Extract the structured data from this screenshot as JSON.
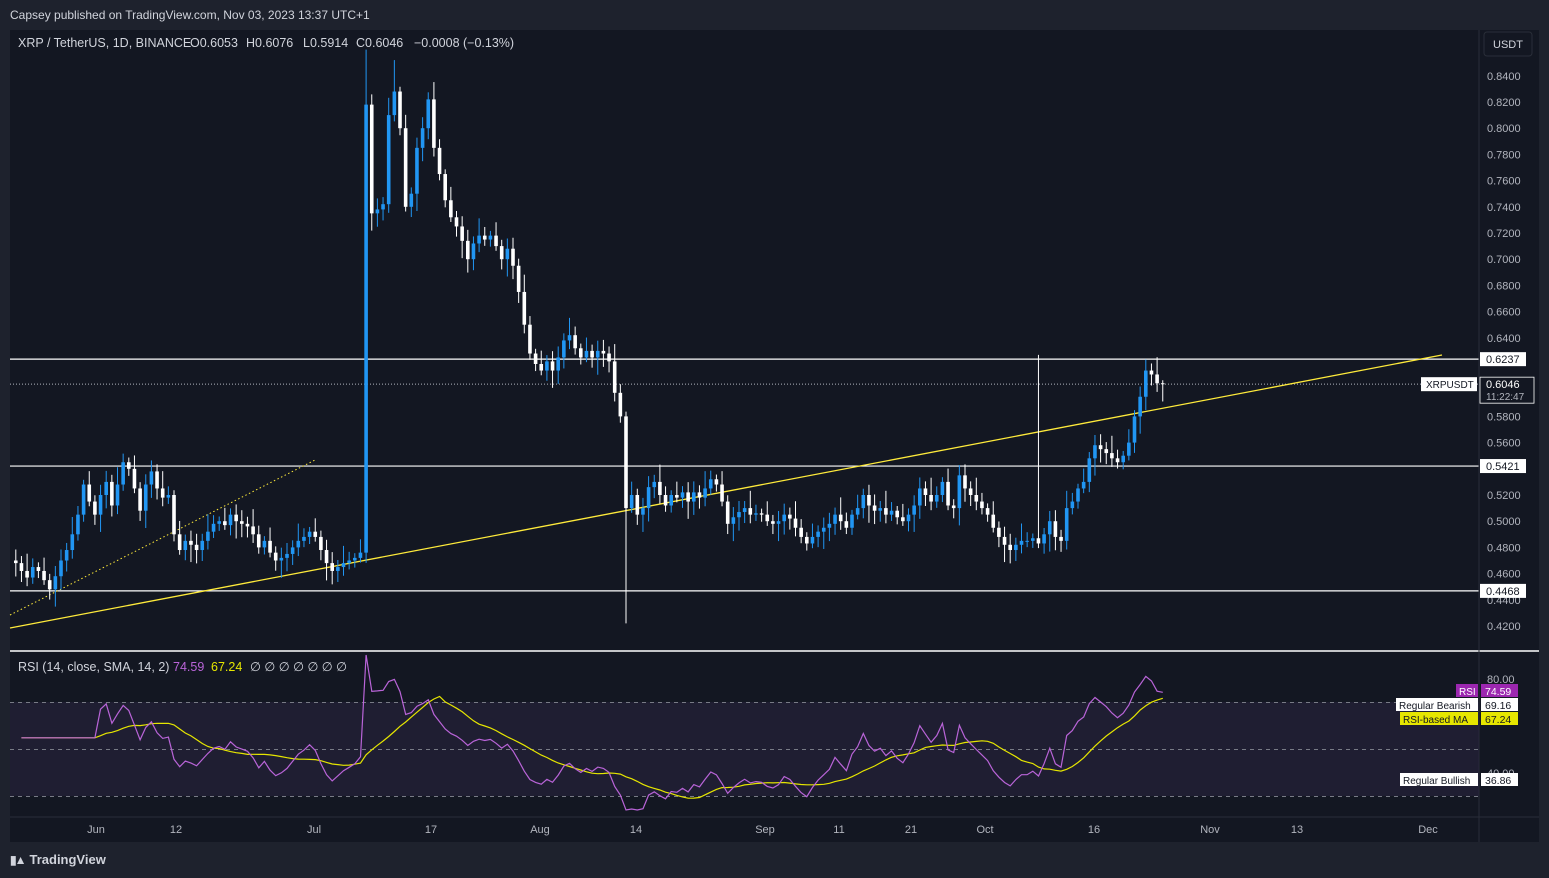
{
  "publisher_line": "Capsey published on TradingView.com, Nov 03, 2023 13:37 UTC+1",
  "header": {
    "symbol": "XRP / TetherUS, 1D, BINANCE",
    "open": "O0.6053",
    "high": "H0.6076",
    "low": "L0.5914",
    "close": "C0.6046",
    "change": "−0.0008 (−0.13%)"
  },
  "currency_button": "USDT",
  "footer_brand": "TradingView",
  "colors": {
    "background": "#131722",
    "up_candle": "#2196f3",
    "down_candle": "#ffffff",
    "trendline": "#ffeb3b",
    "rsi_line": "#b964d8",
    "rsi_ma": "#e6e600",
    "rsi_band": "#2a2540"
  },
  "chart_data": [
    {
      "type": "candlestick",
      "title": "XRP / TetherUS, 1D, BINANCE",
      "ylabel": "USDT",
      "ylim": [
        0.41,
        0.855
      ],
      "y_ticks": [
        "0.8400",
        "0.8200",
        "0.8000",
        "0.7800",
        "0.7600",
        "0.7400",
        "0.7200",
        "0.7000",
        "0.6800",
        "0.6600",
        "0.6400",
        "0.5800",
        "0.5600",
        "0.5200",
        "0.5000",
        "0.4800",
        "0.4600",
        "0.4400",
        "0.4200"
      ],
      "x_ticks": [
        "Jun",
        "12",
        "Jul",
        "17",
        "Aug",
        "14",
        "Sep",
        "11",
        "21",
        "Oct",
        "16",
        "Nov",
        "13",
        "Dec"
      ],
      "candles_close": [
        0.468,
        0.462,
        0.457,
        0.465,
        0.462,
        0.455,
        0.448,
        0.458,
        0.47,
        0.478,
        0.49,
        0.505,
        0.528,
        0.515,
        0.505,
        0.52,
        0.53,
        0.512,
        0.528,
        0.545,
        0.54,
        0.525,
        0.508,
        0.528,
        0.538,
        0.525,
        0.518,
        0.52,
        0.49,
        0.478,
        0.485,
        0.482,
        0.478,
        0.485,
        0.492,
        0.498,
        0.5,
        0.497,
        0.505,
        0.5,
        0.498,
        0.496,
        0.49,
        0.48,
        0.485,
        0.476,
        0.47,
        0.472,
        0.475,
        0.48,
        0.485,
        0.488,
        0.492,
        0.488,
        0.478,
        0.468,
        0.462,
        0.465,
        0.468,
        0.47,
        0.472,
        0.476,
        0.818,
        0.735,
        0.738,
        0.742,
        0.81,
        0.828,
        0.8,
        0.74,
        0.75,
        0.785,
        0.8,
        0.822,
        0.785,
        0.765,
        0.745,
        0.732,
        0.725,
        0.714,
        0.7,
        0.712,
        0.718,
        0.715,
        0.718,
        0.71,
        0.7,
        0.708,
        0.695,
        0.675,
        0.65,
        0.628,
        0.62,
        0.615,
        0.622,
        0.615,
        0.625,
        0.638,
        0.642,
        0.632,
        0.625,
        0.63,
        0.625,
        0.63,
        0.628,
        0.622,
        0.598,
        0.58,
        0.51,
        0.52,
        0.505,
        0.51,
        0.526,
        0.53,
        0.52,
        0.512,
        0.52,
        0.518,
        0.522,
        0.515,
        0.522,
        0.518,
        0.525,
        0.532,
        0.528,
        0.515,
        0.498,
        0.503,
        0.507,
        0.51,
        0.505,
        0.506,
        0.505,
        0.5,
        0.498,
        0.5,
        0.505,
        0.502,
        0.495,
        0.488,
        0.483,
        0.488,
        0.492,
        0.495,
        0.498,
        0.505,
        0.5,
        0.495,
        0.505,
        0.51,
        0.52,
        0.512,
        0.508,
        0.51,
        0.505,
        0.508,
        0.503,
        0.5,
        0.505,
        0.512,
        0.525,
        0.52,
        0.515,
        0.52,
        0.53,
        0.512,
        0.51,
        0.535,
        0.525,
        0.52,
        0.515,
        0.51,
        0.505,
        0.495,
        0.488,
        0.482,
        0.478,
        0.482,
        0.485,
        0.485,
        0.487,
        0.483,
        0.49,
        0.5,
        0.488,
        0.485,
        0.51,
        0.515,
        0.525,
        0.53,
        0.548,
        0.558,
        0.555,
        0.552,
        0.548,
        0.545,
        0.55,
        0.56,
        0.58,
        0.595,
        0.615,
        0.612,
        0.6053
      ],
      "last_close": 0.6046,
      "horizontal_levels": [
        0.6237,
        0.5421,
        0.4468
      ],
      "price_labels": {
        "r1": "0.6237",
        "r2": "0.5421",
        "r3": "0.4468",
        "current": "0.6046",
        "symbol": "XRPUSDT",
        "countdown": "11:22:47"
      }
    },
    {
      "type": "line",
      "title": "RSI (14, close, SMA, 14, 2)",
      "ylim": [
        25,
        88
      ],
      "y_ticks": [
        "80.00",
        "40.00"
      ],
      "bands": [
        70,
        50,
        30
      ],
      "series": [
        {
          "name": "RSI",
          "last": "74.59"
        },
        {
          "name": "RSI-based MA",
          "last": "67.24"
        }
      ],
      "labels": {
        "regular_bearish": "Regular Bearish",
        "regular_bearish_value": "69.16",
        "regular_bullish": "Regular Bullish",
        "regular_bullish_value": "36.86"
      }
    }
  ],
  "rsi_header": {
    "title": "RSI (14, close, SMA, 14, 2)",
    "rsi_value": "74.59",
    "ma_value": "67.24",
    "placeholders": "∅ ∅ ∅ ∅ ∅ ∅ ∅"
  }
}
